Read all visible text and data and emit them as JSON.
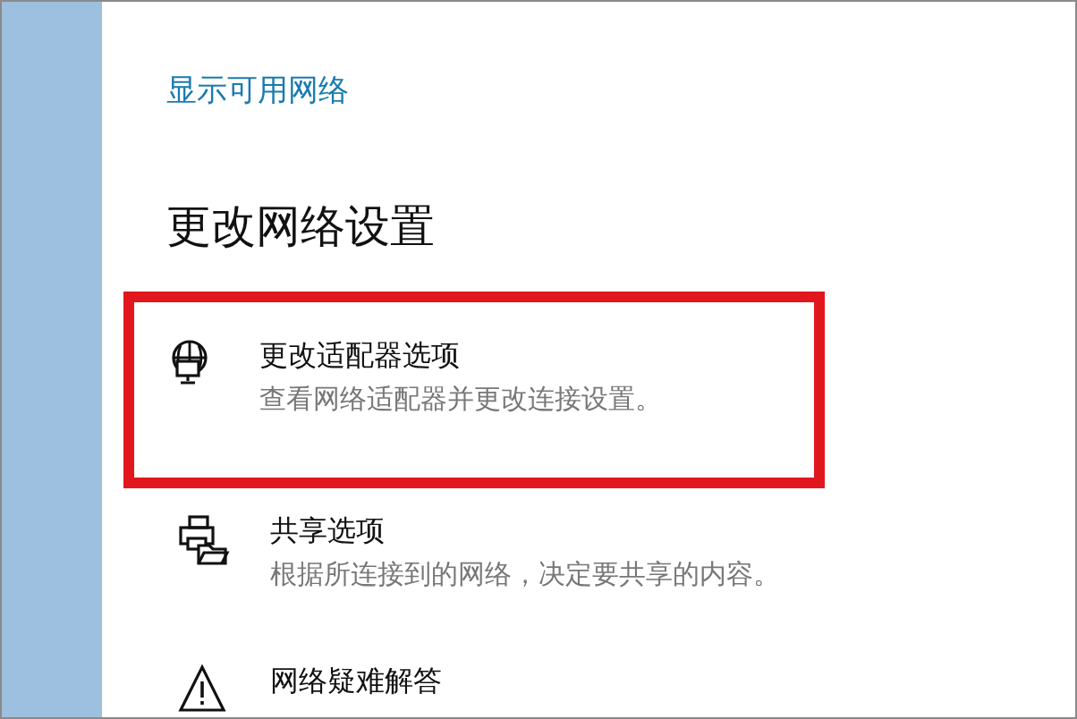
{
  "link": {
    "label": "显示可用网络"
  },
  "section": {
    "title": "更改网络设置"
  },
  "options": [
    {
      "kind": "adapter",
      "title": "更改适配器选项",
      "description": "查看网络适配器并更改连接设置。",
      "highlighted": true
    },
    {
      "kind": "sharing",
      "title": "共享选项",
      "description": "根据所连接到的网络，决定要共享的内容。",
      "highlighted": false
    },
    {
      "kind": "troubleshoot",
      "title": "网络疑难解答",
      "highlighted": false
    }
  ]
}
